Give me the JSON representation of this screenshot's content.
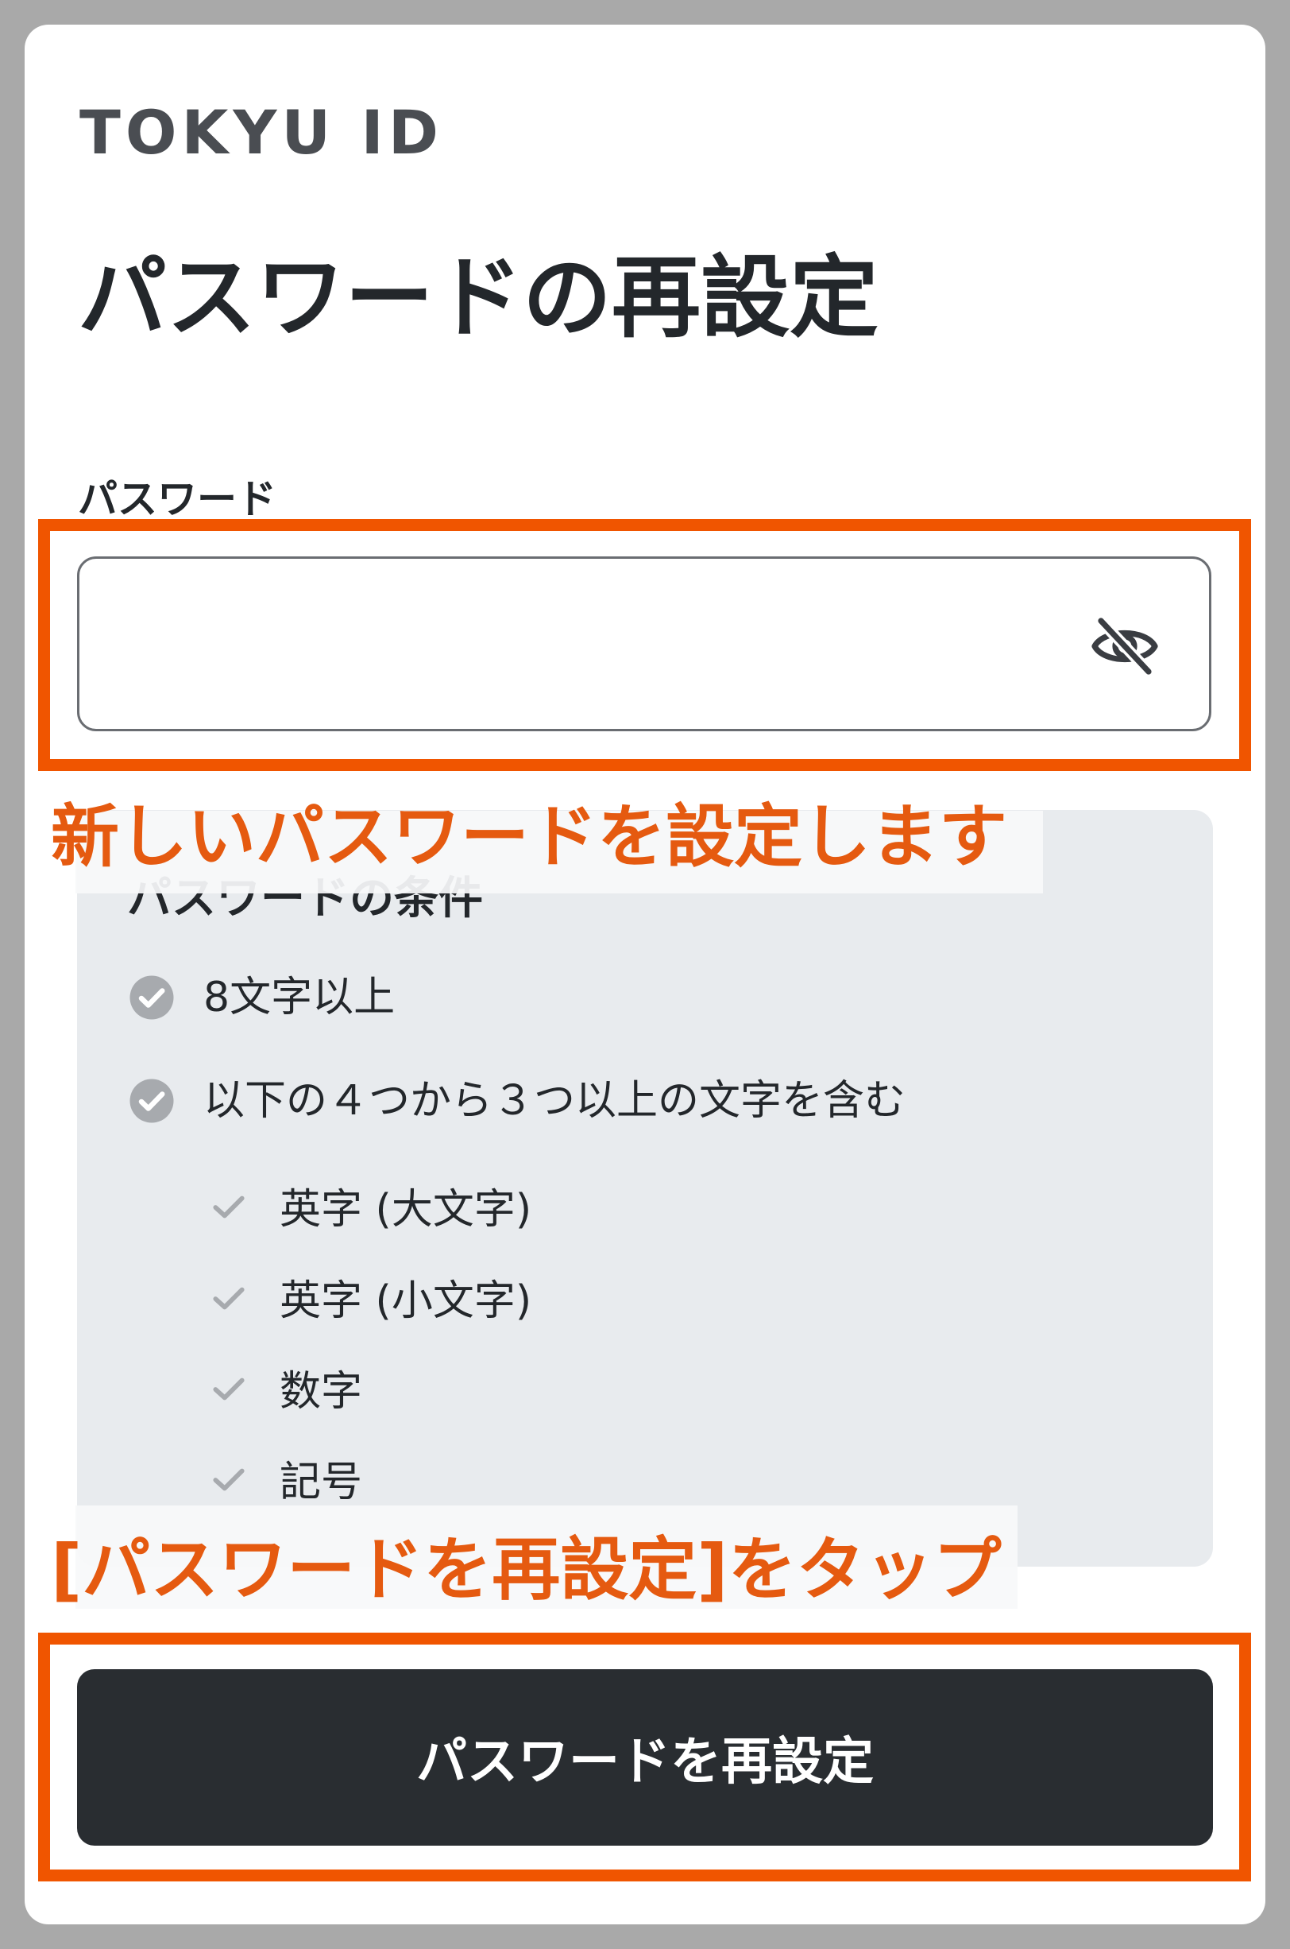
{
  "header": {
    "brand": "TOKYU ID",
    "title": "パスワードの再設定"
  },
  "password_field": {
    "label": "パスワード",
    "value": "",
    "placeholder": "",
    "toggle_icon": "eye-off-icon"
  },
  "conditions": {
    "title": "パスワードの条件",
    "rules": [
      {
        "text": "8文字以上",
        "icon": "check-circle-icon"
      },
      {
        "text": "以下の４つから３つ以上の文字を含む",
        "icon": "check-circle-icon"
      }
    ],
    "sub_rules": [
      {
        "text": "英字 (大文字)",
        "icon": "check-icon"
      },
      {
        "text": "英字 (小文字)",
        "icon": "check-icon"
      },
      {
        "text": "数字",
        "icon": "check-icon"
      },
      {
        "text": "記号",
        "icon": "check-icon"
      }
    ]
  },
  "annotations": {
    "note_password": "新しいパスワードを設定します",
    "note_button": "[パスワードを再設定]をタップ"
  },
  "submit_button": {
    "label": "パスワードを再設定"
  },
  "colors": {
    "annotation_orange": "#f05500",
    "button_dark": "#292d31",
    "panel_gray": "#e8ebee",
    "check_gray": "#a7aaae"
  }
}
